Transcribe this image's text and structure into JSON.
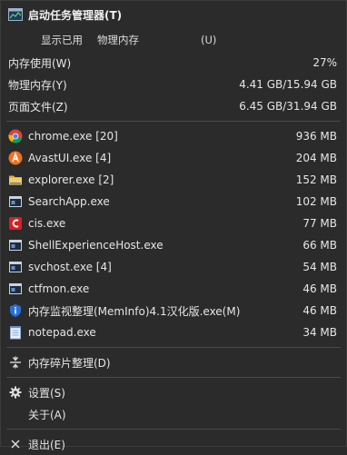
{
  "header": {
    "title": "启动任务管理器(T)"
  },
  "subhead": {
    "show_used": "显示已用",
    "physical_mem": "物理内存",
    "shortcut": "(U)"
  },
  "stats": [
    {
      "label": "内存使用(W)",
      "value": "27%"
    },
    {
      "label": "物理内存(Y)",
      "value": "4.41 GB/15.94 GB"
    },
    {
      "label": "页面文件(Z)",
      "value": "6.45 GB/31.94 GB"
    }
  ],
  "processes": [
    {
      "name": "chrome.exe [20]",
      "mem": "936 MB",
      "icon": "chrome-icon"
    },
    {
      "name": "AvastUI.exe [4]",
      "mem": "204 MB",
      "icon": "avast-icon"
    },
    {
      "name": "explorer.exe [2]",
      "mem": "152 MB",
      "icon": "folder-icon"
    },
    {
      "name": "SearchApp.exe",
      "mem": "102 MB",
      "icon": "window-icon"
    },
    {
      "name": "cis.exe",
      "mem": "77 MB",
      "icon": "cis-icon"
    },
    {
      "name": "ShellExperienceHost.exe",
      "mem": "66 MB",
      "icon": "window-icon"
    },
    {
      "name": "svchost.exe [4]",
      "mem": "54 MB",
      "icon": "window-icon"
    },
    {
      "name": "ctfmon.exe",
      "mem": "46 MB",
      "icon": "window-icon"
    },
    {
      "name": "内存监视整理(MemInfo)4.1汉化版.exe(M)",
      "mem": "46 MB",
      "icon": "shield-info-icon"
    },
    {
      "name": "notepad.exe",
      "mem": "34 MB",
      "icon": "notepad-icon"
    }
  ],
  "actions": {
    "defrag": "内存碎片整理(D)",
    "settings": "设置(S)",
    "about": "关于(A)",
    "exit": "退出(E)"
  },
  "colors": {
    "background": "#2b2b2b",
    "text": "#e6e6e6",
    "separator": "#4a4a4a"
  }
}
